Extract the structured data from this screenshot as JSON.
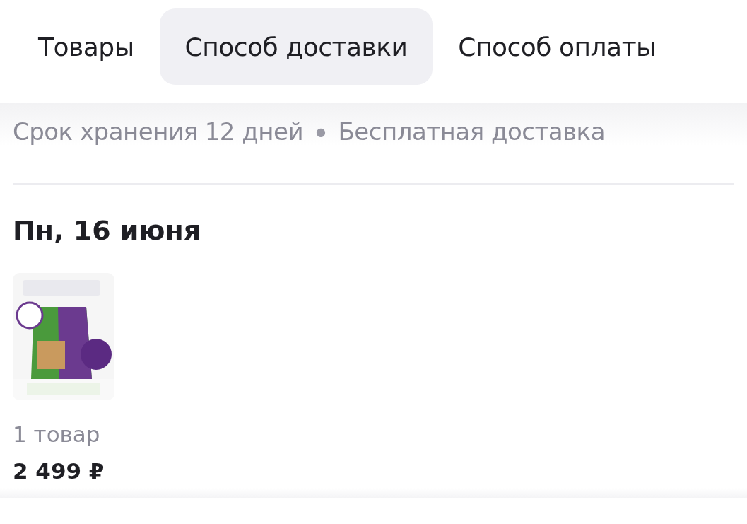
{
  "tabs": [
    {
      "label": "Товары",
      "selected": false
    },
    {
      "label": "Способ доставки",
      "selected": true
    },
    {
      "label": "Способ оплаты",
      "selected": false
    }
  ],
  "delivery_info": {
    "storage": "Срок хранения 12 дней",
    "separator": "●",
    "shipping": "Бесплатная доставка"
  },
  "date": "Пн, 16 июня",
  "summary": {
    "count": "1 товар",
    "price": "2 499 ₽"
  }
}
